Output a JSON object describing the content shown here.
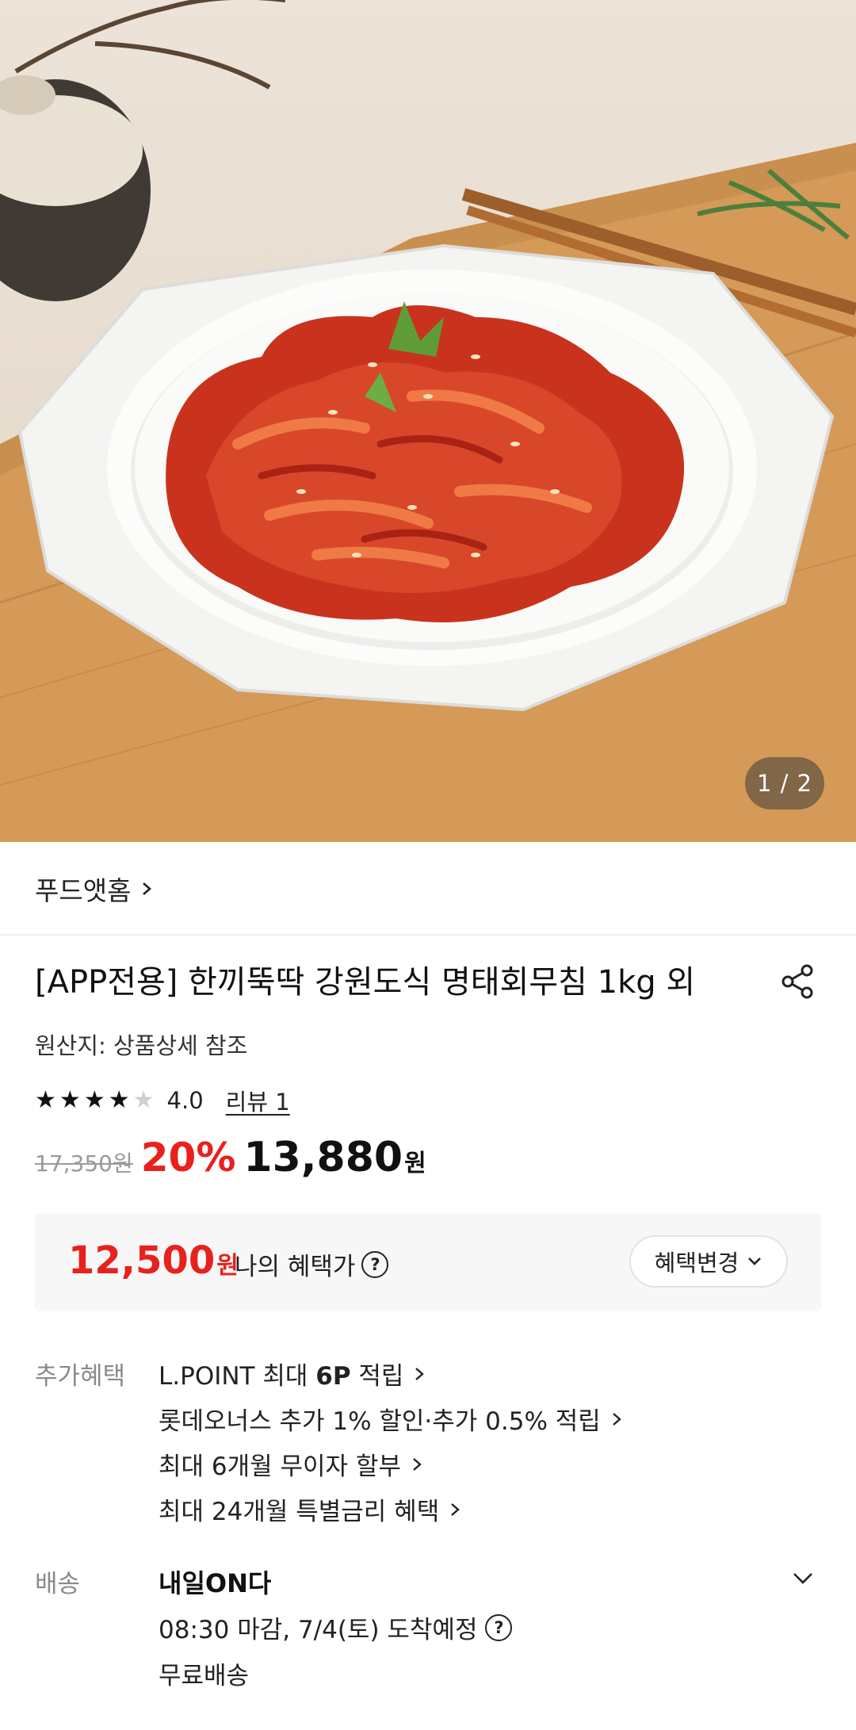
{
  "gallery": {
    "counter": "1 / 2"
  },
  "store": {
    "name": "푸드앳홈"
  },
  "product": {
    "title": "[APP전용] 한끼뚝딱 강원도식 명태회무침 1kg 외",
    "origin": "원산지: 상품상세 참조"
  },
  "rating": {
    "value": "4.0",
    "stars": 4,
    "max": 5,
    "review_label": "리뷰 1"
  },
  "price": {
    "original": "17,350원",
    "discount": "20%",
    "sale": "13,880",
    "currency": "원"
  },
  "benefit": {
    "price": "12,500",
    "currency": "원",
    "label": "나의 혜택가",
    "change_button": "혜택변경"
  },
  "extra_benefits": {
    "label": "추가혜택",
    "items": [
      {
        "prefix": "L.POINT 최대 ",
        "bold": "6P",
        "suffix": " 적립"
      },
      {
        "prefix": "롯데오너스 추가 1% 할인·추가 0.5% 적립",
        "bold": "",
        "suffix": ""
      },
      {
        "prefix": "최대 6개월 무이자 할부",
        "bold": "",
        "suffix": ""
      },
      {
        "prefix": "최대 24개월 특별금리 혜택",
        "bold": "",
        "suffix": ""
      }
    ]
  },
  "delivery": {
    "label": "배송",
    "title": "내일ON다",
    "schedule": "08:30 마감, 7/4(토) 도착예정",
    "fee": "무료배송"
  },
  "colors": {
    "accent_red": "#e8211d",
    "text": "#111111",
    "muted": "#8a8a8a"
  },
  "icons": [
    "chevron-right-icon",
    "share-icon",
    "star-icon",
    "question-icon",
    "chevron-down-icon"
  ]
}
